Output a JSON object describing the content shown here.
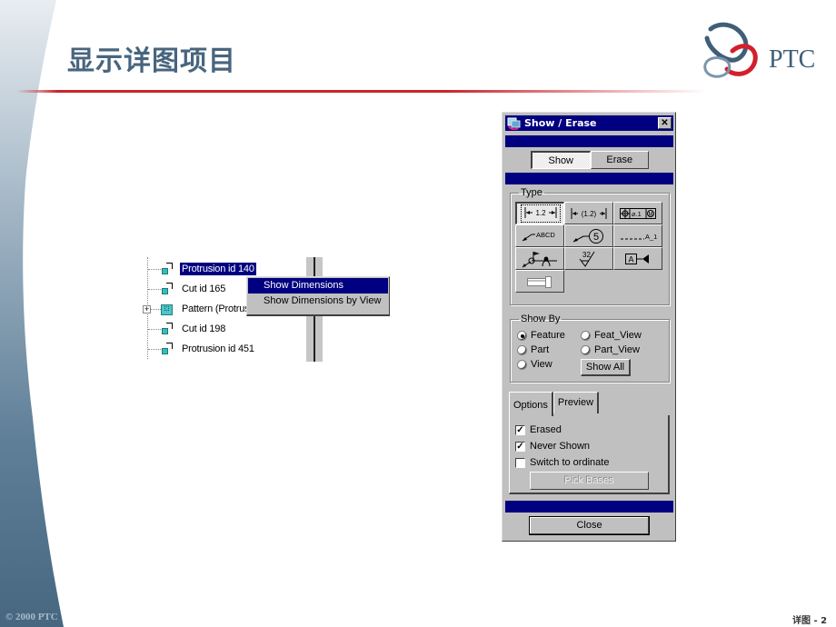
{
  "slide": {
    "title": "显示详图项目",
    "logo_text": "PTC",
    "copyright": "© 2000 PTC",
    "page_label": "详图 - 2",
    "colors": {
      "title": "#48657e",
      "rule": "#c8242c",
      "band": "#4a6a85",
      "selection": "#000080"
    }
  },
  "model_tree": {
    "items": [
      {
        "label": "Protrusion id 140",
        "icon": "feature-icon",
        "selected": true
      },
      {
        "label": "Cut id 165",
        "icon": "feature-icon",
        "selected": false
      },
      {
        "label": "Pattern (Protrusi",
        "icon": "pattern-icon",
        "expander": "+",
        "selected": false
      },
      {
        "label": "Cut id 198",
        "icon": "feature-icon",
        "selected": false
      },
      {
        "label": "Protrusion id 451",
        "icon": "feature-icon",
        "selected": false
      }
    ]
  },
  "context_menu": {
    "items": [
      {
        "label": "Show Dimensions",
        "active": true
      },
      {
        "label": "Show Dimensions by View",
        "active": false
      }
    ]
  },
  "dialog": {
    "title": "Show / Erase",
    "close_glyph": "✕",
    "modes": {
      "show": "Show",
      "erase": "Erase",
      "selected": "Show"
    },
    "type_group": {
      "legend": "Type",
      "buttons": [
        {
          "name": "dimension",
          "glyph": "|←1.2→|",
          "pressed": true
        },
        {
          "name": "reference-dimension",
          "glyph": "|←(1.2)→|",
          "pressed": false
        },
        {
          "name": "geometric-tolerance",
          "glyph": "⊕|⌀.1Ⓜ",
          "pressed": false
        },
        {
          "name": "note",
          "glyph": "↙ABCD",
          "pressed": false
        },
        {
          "name": "balloon",
          "glyph": "↙⑤",
          "pressed": false
        },
        {
          "name": "axis",
          "glyph": "-----A_1",
          "pressed": false
        },
        {
          "name": "symbol",
          "glyph": "⚑⌒",
          "pressed": false
        },
        {
          "name": "surface-finish",
          "glyph": "32√",
          "pressed": false
        },
        {
          "name": "datum-target",
          "glyph": "[A]◀",
          "pressed": false
        },
        {
          "name": "cosmetic-feature",
          "glyph": "▭",
          "pressed": false
        }
      ]
    },
    "show_by": {
      "legend": "Show By",
      "options": [
        {
          "label": "Feature",
          "checked": true
        },
        {
          "label": "Feat_View",
          "checked": false
        },
        {
          "label": "Part",
          "checked": false
        },
        {
          "label": "Part_View",
          "checked": false
        },
        {
          "label": "View",
          "checked": false
        }
      ],
      "show_all_label": "Show All"
    },
    "tabs": [
      {
        "label": "Options",
        "active": true
      },
      {
        "label": "Preview",
        "active": false
      }
    ],
    "options": [
      {
        "label": "Erased",
        "checked": true
      },
      {
        "label": "Never Shown",
        "checked": true
      },
      {
        "label": "Switch to ordinate",
        "checked": false
      }
    ],
    "pick_bases_label": "Pick Bases",
    "pick_bases_enabled": false,
    "close_label": "Close"
  }
}
